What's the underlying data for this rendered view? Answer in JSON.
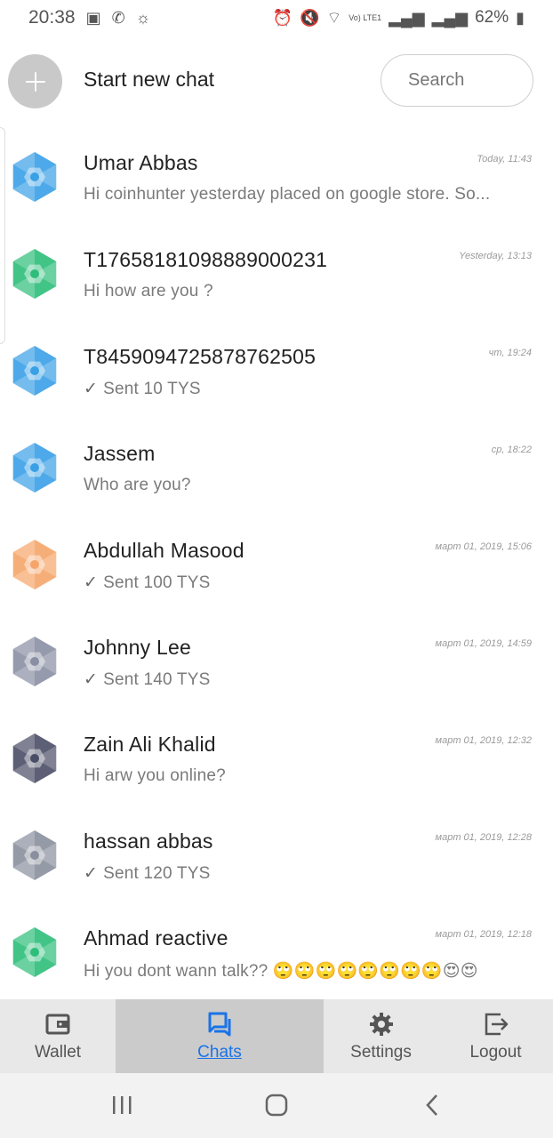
{
  "status_bar": {
    "time": "20:38",
    "battery": "62%",
    "network": "Vo) LTE1"
  },
  "top_row": {
    "new_chat_label": "Start new chat",
    "search_placeholder": "Search"
  },
  "chats": [
    {
      "name": "Umar Abbas",
      "time": "Today, 11:43",
      "message": "Hi coinhunter yesterday placed on google store. So...",
      "sent": false,
      "avatar_color": "#3aa0e6"
    },
    {
      "name": "T17658181098889000231",
      "time": "Yesterday, 13:13",
      "message": "Hi how are you ?",
      "sent": false,
      "avatar_color": "#2ebd7a"
    },
    {
      "name": "T8459094725878762505",
      "time": "чт, 19:24",
      "message": "Sent 10 TYS",
      "sent": true,
      "avatar_color": "#3aa0e6"
    },
    {
      "name": "Jassem",
      "time": "ср, 18:22",
      "message": "Who are you?",
      "sent": false,
      "avatar_color": "#3aa0e6"
    },
    {
      "name": "Abdullah Masood",
      "time": "март 01, 2019, 15:06",
      "message": "Sent 100 TYS",
      "sent": true,
      "avatar_color": "#f5a56a"
    },
    {
      "name": "Johnny Lee",
      "time": "март 01, 2019, 14:59",
      "message": "Sent 140 TYS",
      "sent": true,
      "avatar_color": "#8a8fa3"
    },
    {
      "name": "Zain Ali Khalid",
      "time": "март 01, 2019, 12:32",
      "message": "Hi arw you online?",
      "sent": false,
      "avatar_color": "#4a4d66"
    },
    {
      "name": "hassan abbas",
      "time": "март 01, 2019, 12:28",
      "message": "Sent 120 TYS",
      "sent": true,
      "avatar_color": "#8a8f9e"
    },
    {
      "name": "Ahmad reactive",
      "time": "март 01, 2019, 12:18",
      "message": "Hi you dont wann talk?? 🙄🙄🙄🙄🙄🙄🙄🙄😍😍",
      "sent": false,
      "avatar_color": "#2ebd7a"
    }
  ],
  "bottom_nav": {
    "wallet": "Wallet",
    "chats": "Chats",
    "settings": "Settings",
    "logout": "Logout"
  },
  "colors": {
    "accent": "#1a73e8",
    "nav_bg": "#e8e8e8",
    "nav_active_bg": "#cbcbcb"
  }
}
